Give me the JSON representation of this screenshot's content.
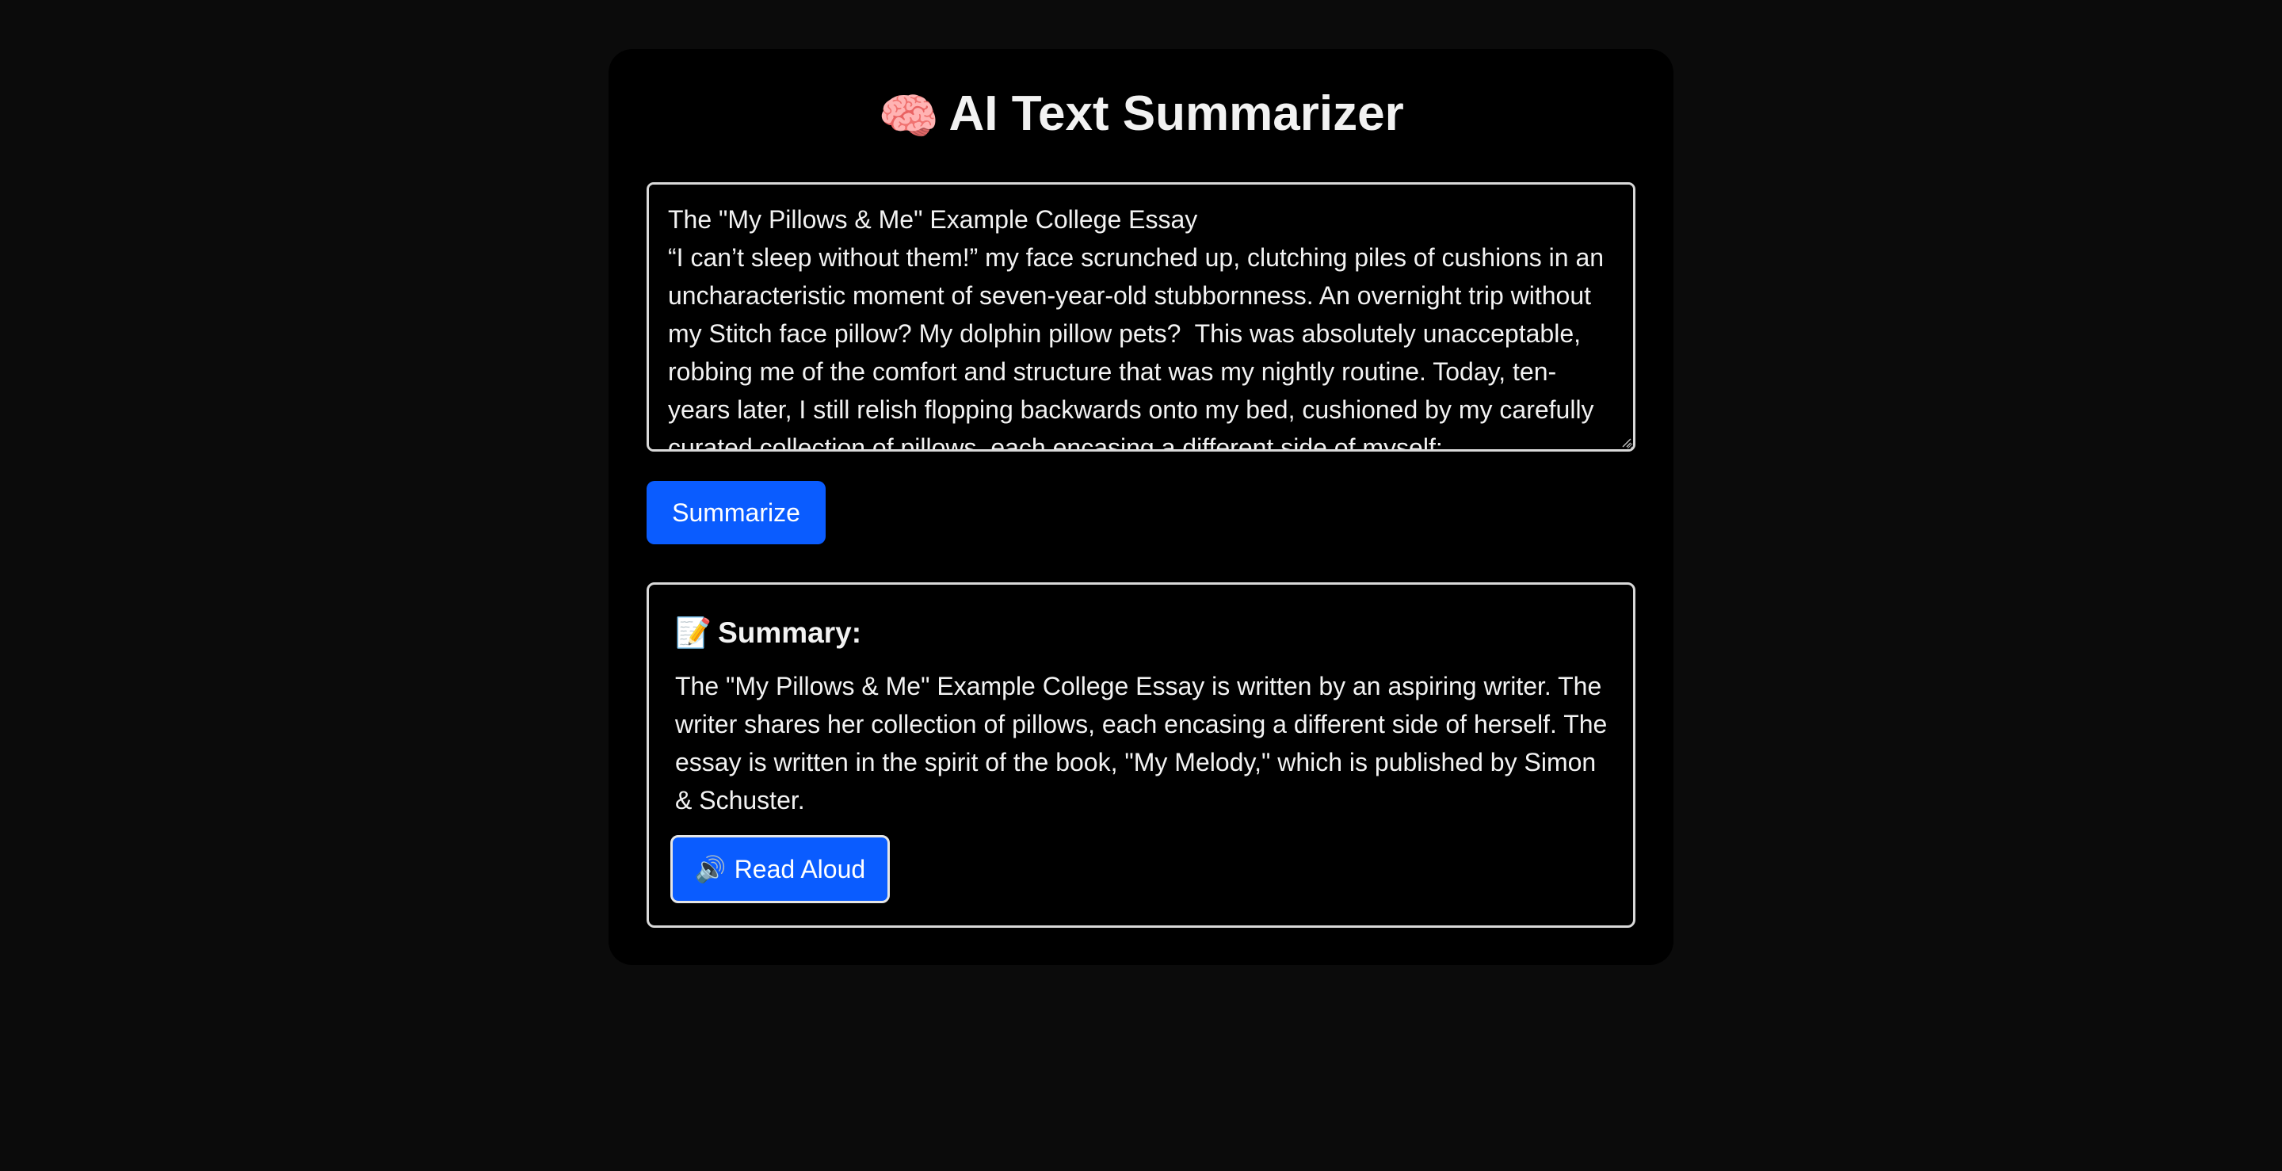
{
  "app": {
    "title_icon": "🧠",
    "title": "AI Text Summarizer"
  },
  "input": {
    "value": "The \"My Pillows & Me\" Example College Essay\n“I can’t sleep without them!” my face scrunched up, clutching piles of cushions in an uncharacteristic moment of seven-year-old stubbornness. An overnight trip without my Stitch face pillow? My dolphin pillow pets?  This was absolutely unacceptable, robbing me of the comfort and structure that was my nightly routine. Today, ten-years later, I still relish flopping backwards onto my bed, cushioned by my carefully curated collection of pillows, each encasing a different side of myself:"
  },
  "actions": {
    "summarize_label": "Summarize"
  },
  "summary": {
    "heading_icon": "📝",
    "heading": "Summary:",
    "text": "The \"My Pillows & Me\" Example College Essay is written by an aspiring writer. The writer shares her collection of pillows, each encasing a different side of herself. The essay is written in the spirit of the book, \"My Melody,\" which is published by Simon & Schuster.",
    "read_aloud_icon": "🔊",
    "read_aloud_label": "Read Aloud"
  },
  "colors": {
    "page_bg": "#0b0b0b",
    "card_bg": "#000000",
    "accent": "#0a5cff",
    "text": "#f2f2f2",
    "border": "#d9d9d9"
  }
}
